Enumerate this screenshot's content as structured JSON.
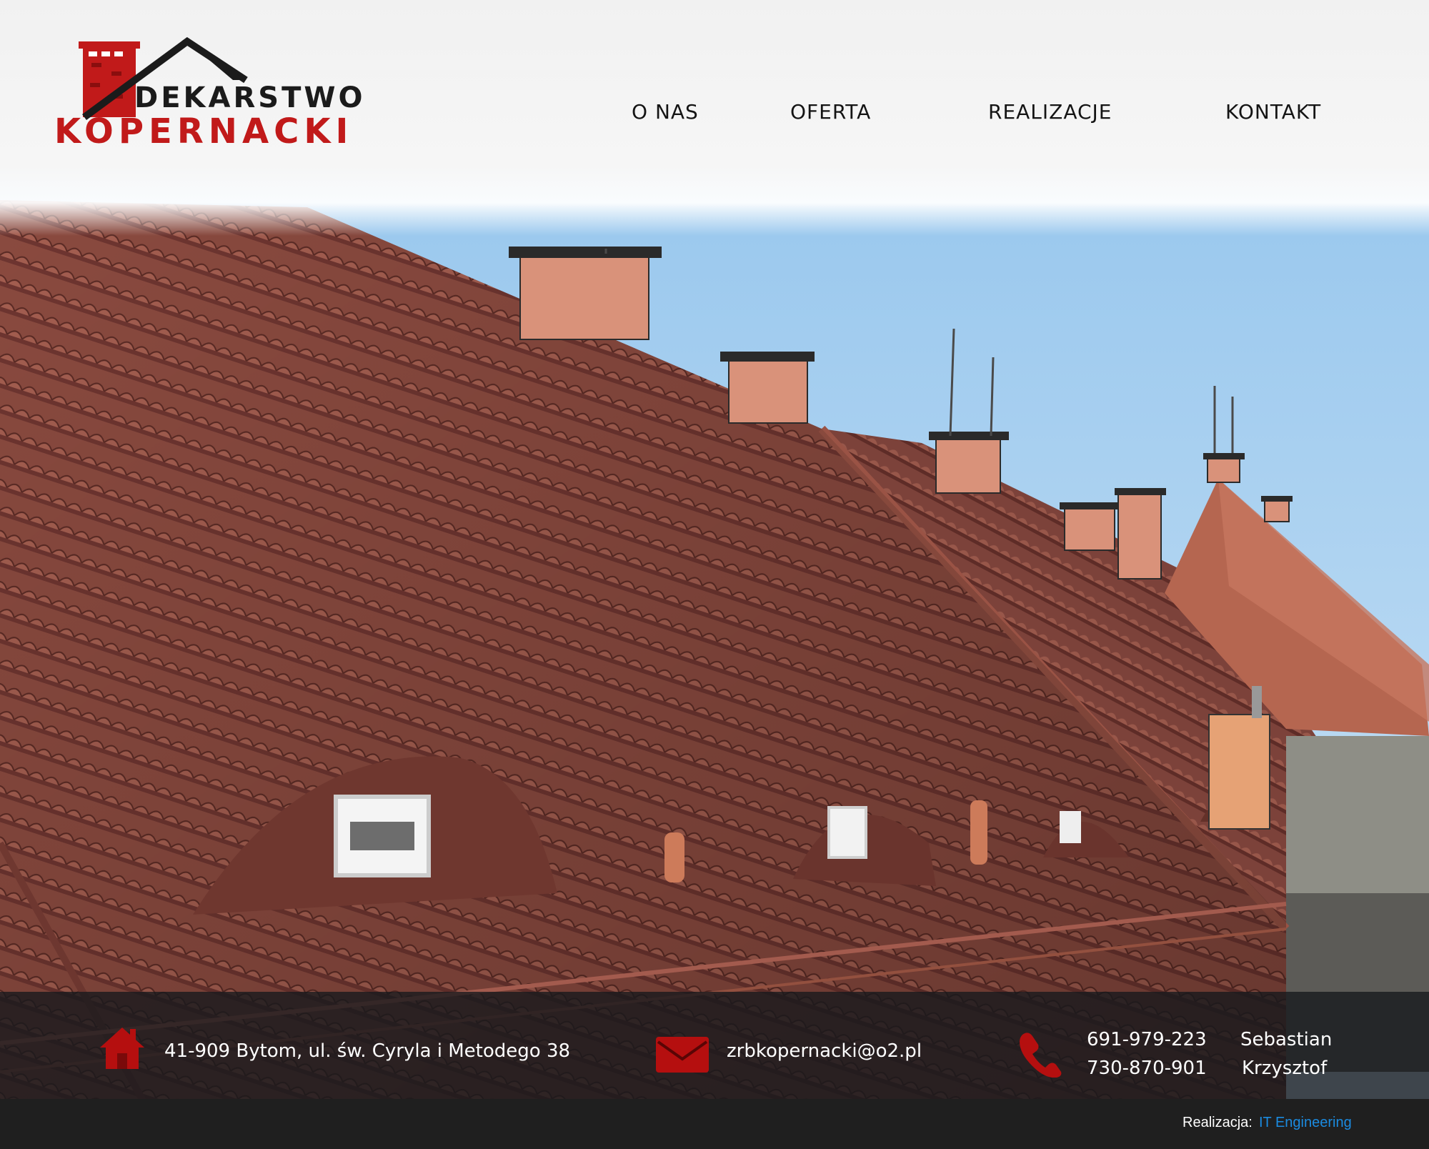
{
  "brand": {
    "line1": "DEKARSTWO",
    "line2": "KOPERNACKI",
    "red": "#c11a1a",
    "dark": "#1b1b1b"
  },
  "nav": {
    "items": [
      {
        "label": "O NAS"
      },
      {
        "label": "OFERTA"
      },
      {
        "label": "REALIZACJE"
      },
      {
        "label": "KONTAKT"
      }
    ]
  },
  "contact": {
    "address": "41-909 Bytom, ul. św. Cyryla i Metodego 38",
    "email": "zrbkopernacki@o2.pl",
    "phones": [
      {
        "number": "691-979-223",
        "name": "Sebastian"
      },
      {
        "number": "730-870-901",
        "name": "Krzysztof"
      }
    ],
    "icons": [
      "home-icon",
      "envelope-icon",
      "phone-icon"
    ],
    "icon_color": "#b50f0f"
  },
  "credit": {
    "label": "Realizacja:",
    "link": "IT Engineering",
    "link_color": "#1b8be0"
  }
}
